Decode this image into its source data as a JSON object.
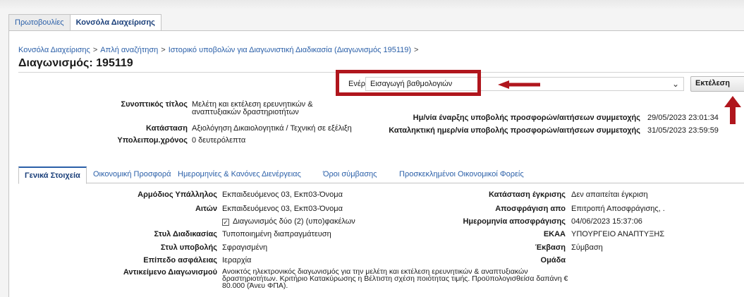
{
  "top_tabs": [
    {
      "label": "Πρωτοβουλίες"
    },
    {
      "label": "Κονσόλα Διαχείρισης"
    }
  ],
  "breadcrumb": [
    "Κονσόλα Διαχείρισης",
    "Απλή αναζήτηση",
    "Ιστορικό υποβολών για Διαγωνιστική Διαδικασία (Διαγωνισμός 195119)"
  ],
  "breadcrumb_sep": ">",
  "page_title": "Διαγωνισμός: 195119",
  "actions": {
    "label": "Ενέργειες",
    "selected": "Εισαγωγή βαθμολογιών",
    "execute": "Εκτέλεση"
  },
  "header": {
    "summary_title_label": "Συνοπτικός τίτλος",
    "summary_title_value_1": "Μελέτη και εκτέλεση ερευνητικών &",
    "summary_title_value_2": "αναπτυξιακών δραστηριοτήτων",
    "status_label": "Κατάσταση",
    "status_value": "Αξιολόγηση Δικαιολογητικά / Τεχνική σε εξέλιξη",
    "remaining_label": "Υπολειπομ.χρόνος",
    "remaining_value": "0 δευτερόλεπτα",
    "start_label": "Ημ/νία έναρξης υποβολής προσφορών/αιτήσεων συμμετοχής",
    "start_value": "29/05/2023 23:01:34",
    "end_label": "Καταληκτική ημερ/νία υποβολής προσφορών/αιτήσεων συμμετοχής",
    "end_value": "31/05/2023 23:59:59"
  },
  "sub_tabs": [
    {
      "label": "Γενικά Στοιχεία"
    },
    {
      "label": "Οικονομική Προσφορά"
    },
    {
      "label": "Ημερομηνίες & Κανόνες Διενέργειας"
    },
    {
      "label": "Όροι σύμβασης"
    },
    {
      "label": "Προσκεκλημένοι Οικονομικοί Φορείς"
    }
  ],
  "general": {
    "responsible_label": "Αρμόδιος Υπάλληλος",
    "responsible_value": "Εκπαιδευόμενος 03, Εκπ03-Όνομα",
    "requester_label": "Αιτών",
    "requester_value": "Εκπαιδευόμενος 03, Εκπ03-Όνομα",
    "two_envelopes_label": "Διαγωνισμός δύο (2) (υπο)φακέλων",
    "procedure_style_label": "Στυλ Διαδικασίας",
    "procedure_style_value": "Τυποποιημένη διαπραγμάτευση",
    "submission_style_label": "Στυλ υποβολής",
    "submission_style_value": "Σφραγισμένη",
    "security_label": "Επίπεδο ασφάλειας",
    "security_value": "Ιεραρχία",
    "subject_label": "Αντικείμενο Διαγωνισμού",
    "subject_line_1": "Ανοικτός ηλεκτρονικός διαγωνισμός για την  μελέτη και εκτέλεση ερευνητικών & αναπτυξιακών",
    "subject_line_2": "δραστηριοτήτων. Κριτήριο Κατακύρωσης η Βέλτιστη σχέση ποιότητας τιμής. Προϋπολογισθείσα δαπάνη €",
    "subject_line_3": "80.000 (Άνευ ΦΠΑ).",
    "approval_label": "Κατάσταση έγκρισης",
    "approval_value": "Δεν απαιτείται έγκριση",
    "unseal_by_label": "Αποσφράγιση απο",
    "unseal_by_value": "Επιτροπή Αποσφράγισης, .",
    "unseal_date_label": "Ημερομηνία αποσφράγισης",
    "unseal_date_value": "04/06/2023 15:37:06",
    "ekaa_label": "ΕΚΑΑ",
    "ekaa_value": "ΥΠΟΥΡΓΕΙΟ ΑΝΑΠΤΥΞΗΣ",
    "outcome_label": "Έκβαση",
    "outcome_value": "Σύμβαση",
    "group_label": "Ομάδα"
  },
  "colors": {
    "highlight_red": "#b0161d",
    "link_blue": "#2a5fa8"
  }
}
